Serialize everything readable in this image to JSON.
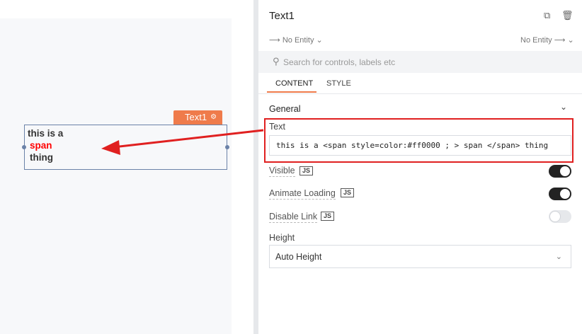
{
  "canvas": {
    "widget_tag_label": "Text1",
    "widget_lines": [
      "this is a",
      "span",
      "thing"
    ]
  },
  "pane": {
    "title": "Text1",
    "entity_left": "No Entity",
    "entity_right": "No Entity",
    "search_placeholder": "Search for controls, labels etc",
    "tabs": [
      "CONTENT",
      "STYLE"
    ],
    "section_title": "General",
    "text_label": "Text",
    "text_value": "this is a <span style=color:#ff0000 ; > span </span> thing",
    "visible_label": "Visible",
    "animate_label": "Animate Loading",
    "disable_link_label": "Disable Link",
    "js_badge": "JS",
    "height_label": "Height",
    "height_value": "Auto Height"
  },
  "colors": {
    "accent": "#ef7b4b",
    "highlight": "#e02020",
    "span_text": "#ff0000"
  },
  "toggles": {
    "visible": true,
    "animate_loading": true,
    "disable_link": false
  }
}
